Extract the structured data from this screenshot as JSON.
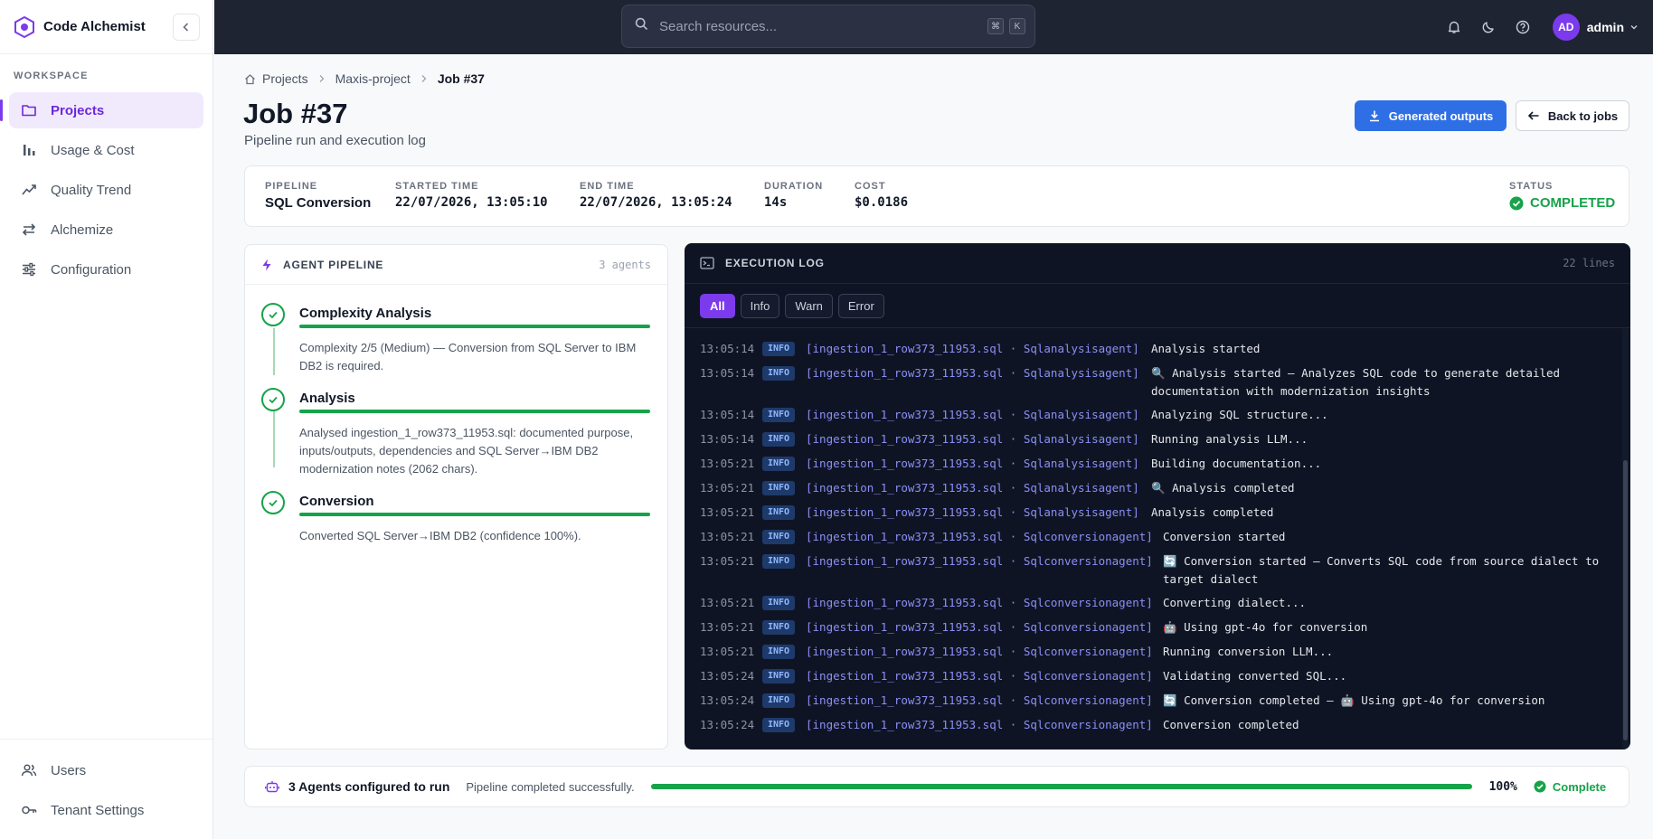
{
  "app": {
    "name": "Code Alchemist"
  },
  "sidebar": {
    "section_label": "WORKSPACE",
    "items": [
      {
        "label": "Projects",
        "icon": "folder-icon",
        "active": true
      },
      {
        "label": "Usage & Cost",
        "icon": "bar-chart-icon"
      },
      {
        "label": "Quality Trend",
        "icon": "trend-icon"
      },
      {
        "label": "Alchemize",
        "icon": "swap-icon"
      },
      {
        "label": "Configuration",
        "icon": "sliders-icon"
      }
    ],
    "bottom_items": [
      {
        "label": "Users",
        "icon": "users-icon"
      },
      {
        "label": "Tenant Settings",
        "icon": "key-icon"
      }
    ]
  },
  "topbar": {
    "search_placeholder": "Search resources...",
    "shortcut_keys": [
      "⌘",
      "K"
    ],
    "user_initials": "AD",
    "user_name": "admin"
  },
  "breadcrumb": [
    "Projects",
    "Maxis-project",
    "Job #37"
  ],
  "header": {
    "title": "Job #37",
    "subtitle": "Pipeline run and execution log",
    "primary_button": "Generated outputs",
    "back_button": "Back to jobs"
  },
  "summary": {
    "pipeline_label": "PIPELINE",
    "pipeline": "SQL Conversion",
    "started_label": "STARTED TIME",
    "started": "22/07/2026, 13:05:10",
    "end_label": "END TIME",
    "end": "22/07/2026, 13:05:24",
    "duration_label": "DURATION",
    "duration": "14s",
    "cost_label": "COST",
    "cost": "$0.0186",
    "status_label": "STATUS",
    "status": "COMPLETED"
  },
  "agent_pipeline": {
    "title": "AGENT PIPELINE",
    "count": "3 agents",
    "steps": [
      {
        "name": "Complexity Analysis",
        "progress": 1.0,
        "desc": "Complexity 2/5 (Medium) — Conversion from SQL Server to IBM DB2 is required."
      },
      {
        "name": "Analysis",
        "progress": 1.0,
        "desc": "Analysed ingestion_1_row373_11953.sql: documented purpose, inputs/outputs, dependencies and SQL Server→IBM DB2 modernization notes (2062 chars)."
      },
      {
        "name": "Conversion",
        "progress": 1.0,
        "desc": "Converted SQL Server→IBM DB2 (confidence 100%)."
      }
    ]
  },
  "execution_log": {
    "title": "EXECUTION LOG",
    "count": "22 lines",
    "filters": [
      "All",
      "Info",
      "Warn",
      "Error"
    ],
    "active_filter": "All",
    "rows": [
      {
        "time": "13:05:14",
        "level": "INFO",
        "source": "[ingestion_1_row373_11953.sql · Sqlanalysisagent]",
        "message": "Analysis started"
      },
      {
        "time": "13:05:14",
        "level": "INFO",
        "source": "[ingestion_1_row373_11953.sql · Sqlanalysisagent]",
        "message": "🔍 Analysis started — Analyzes SQL code to generate detailed\ndocumentation with modernization insights"
      },
      {
        "time": "13:05:14",
        "level": "INFO",
        "source": "[ingestion_1_row373_11953.sql · Sqlanalysisagent]",
        "message": "Analyzing SQL structure..."
      },
      {
        "time": "13:05:14",
        "level": "INFO",
        "source": "[ingestion_1_row373_11953.sql · Sqlanalysisagent]",
        "message": "Running analysis LLM..."
      },
      {
        "time": "13:05:21",
        "level": "INFO",
        "source": "[ingestion_1_row373_11953.sql · Sqlanalysisagent]",
        "message": "Building documentation..."
      },
      {
        "time": "13:05:21",
        "level": "INFO",
        "source": "[ingestion_1_row373_11953.sql · Sqlanalysisagent]",
        "message": "🔍 Analysis completed"
      },
      {
        "time": "13:05:21",
        "level": "INFO",
        "source": "[ingestion_1_row373_11953.sql · Sqlanalysisagent]",
        "message": "Analysis completed"
      },
      {
        "time": "13:05:21",
        "level": "INFO",
        "source": "[ingestion_1_row373_11953.sql · Sqlconversionagent]",
        "message": "Conversion started"
      },
      {
        "time": "13:05:21",
        "level": "INFO",
        "source": "[ingestion_1_row373_11953.sql · Sqlconversionagent]",
        "message": "🔄 Conversion started — Converts SQL code from source dialect to\ntarget dialect"
      },
      {
        "time": "13:05:21",
        "level": "INFO",
        "source": "[ingestion_1_row373_11953.sql · Sqlconversionagent]",
        "message": "Converting dialect..."
      },
      {
        "time": "13:05:21",
        "level": "INFO",
        "source": "[ingestion_1_row373_11953.sql · Sqlconversionagent]",
        "message": "🤖 Using gpt-4o for conversion"
      },
      {
        "time": "13:05:21",
        "level": "INFO",
        "source": "[ingestion_1_row373_11953.sql · Sqlconversionagent]",
        "message": "Running conversion LLM..."
      },
      {
        "time": "13:05:24",
        "level": "INFO",
        "source": "[ingestion_1_row373_11953.sql · Sqlconversionagent]",
        "message": "Validating converted SQL..."
      },
      {
        "time": "13:05:24",
        "level": "INFO",
        "source": "[ingestion_1_row373_11953.sql · Sqlconversionagent]",
        "message": "🔄 Conversion completed — 🤖 Using gpt-4o for conversion"
      },
      {
        "time": "13:05:24",
        "level": "INFO",
        "source": "[ingestion_1_row373_11953.sql · Sqlconversionagent]",
        "message": "Conversion completed"
      }
    ]
  },
  "footer": {
    "agents_text": "3 Agents configured to run",
    "message": "Pipeline completed successfully.",
    "progress_percent": 100,
    "progress_label": "100%",
    "status": "Complete"
  },
  "colors": {
    "accent": "#7c3aed",
    "primary_button": "#2f6fe6",
    "success": "#16a34a",
    "topbar": "#1f2433",
    "log_bg": "#0f1424"
  }
}
